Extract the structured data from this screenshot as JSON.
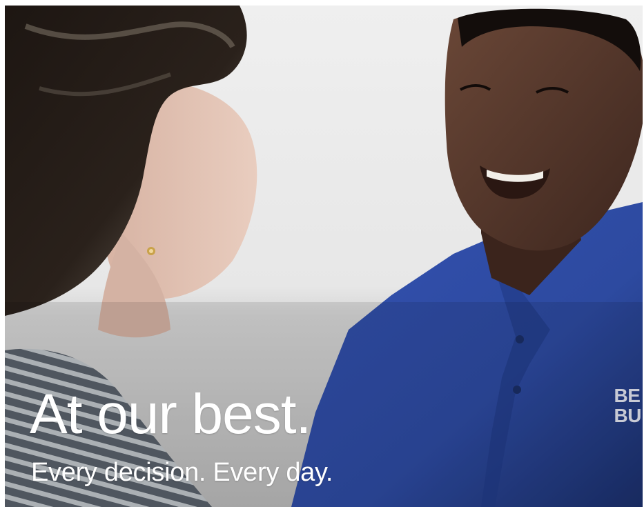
{
  "hero": {
    "headline": "At our best.",
    "subheadline": "Every decision. Every day."
  },
  "logo": {
    "line1": "BE",
    "line2": "BU"
  },
  "colors": {
    "shirt": "#2f4aa2",
    "shirt_shadow": "#1f336f",
    "background_light": "#ececec",
    "background_shadow": "#bdbdbd",
    "text": "#ffffff"
  },
  "icons": {
    "brand": "best-buy-logo-icon"
  }
}
